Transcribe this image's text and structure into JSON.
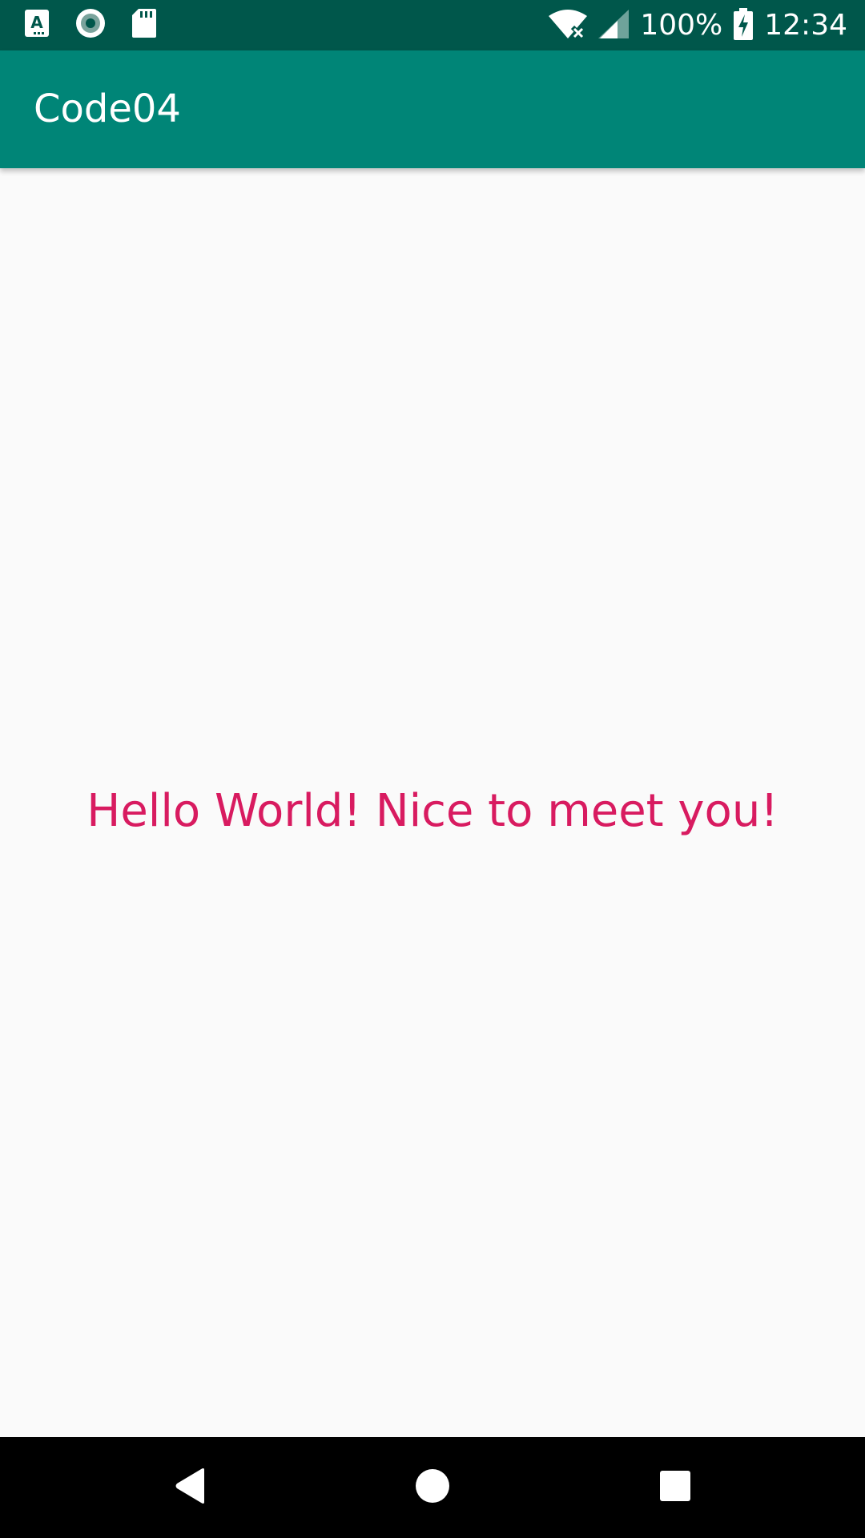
{
  "status_bar": {
    "battery_percent": "100%",
    "time": "12:34",
    "left_icons": [
      "font-a-icon",
      "record-circle-icon",
      "sd-card-icon"
    ],
    "right_icons": [
      "wifi-off-icon",
      "cell-signal-icon",
      "battery-charging-icon"
    ],
    "background_color": "#00574b"
  },
  "app_bar": {
    "title": "Code04",
    "background_color": "#008577"
  },
  "content": {
    "message": "Hello World! Nice to meet you!",
    "message_color": "#d81b60",
    "background_color": "#fafafa"
  },
  "nav_bar": {
    "buttons": [
      "back-icon",
      "home-icon",
      "recents-icon"
    ]
  }
}
